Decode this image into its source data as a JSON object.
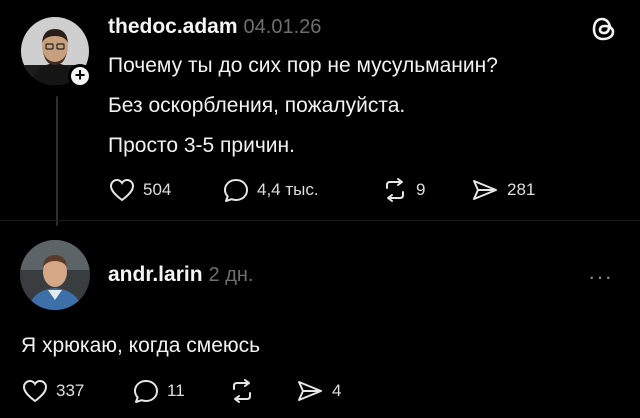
{
  "post": {
    "username": "thedoc.adam",
    "date": "04.01.26",
    "lines": [
      "Почему ты до сих пор не мусульманин?",
      "Без оскорбления, пожалуйста.",
      "Просто 3-5 причин."
    ],
    "likes": "504",
    "comments": "4,4 тыс.",
    "reposts": "9",
    "shares": "281",
    "follow_badge": "+"
  },
  "reply": {
    "username": "andr.larin",
    "date": "2 дн.",
    "text": "Я хрюкаю, когда смеюсь",
    "likes": "337",
    "comments": "11",
    "reposts": "",
    "shares": "4",
    "more": "···"
  },
  "icons": {
    "threads_logo": "threads-logo-icon",
    "like": "heart-icon",
    "comment": "comment-bubble-icon",
    "repost": "repost-icon",
    "share": "send-icon",
    "more": "more-dots-icon"
  },
  "colors": {
    "background": "#000000",
    "text": "#f3f3f3",
    "muted": "#6f6f6f"
  }
}
